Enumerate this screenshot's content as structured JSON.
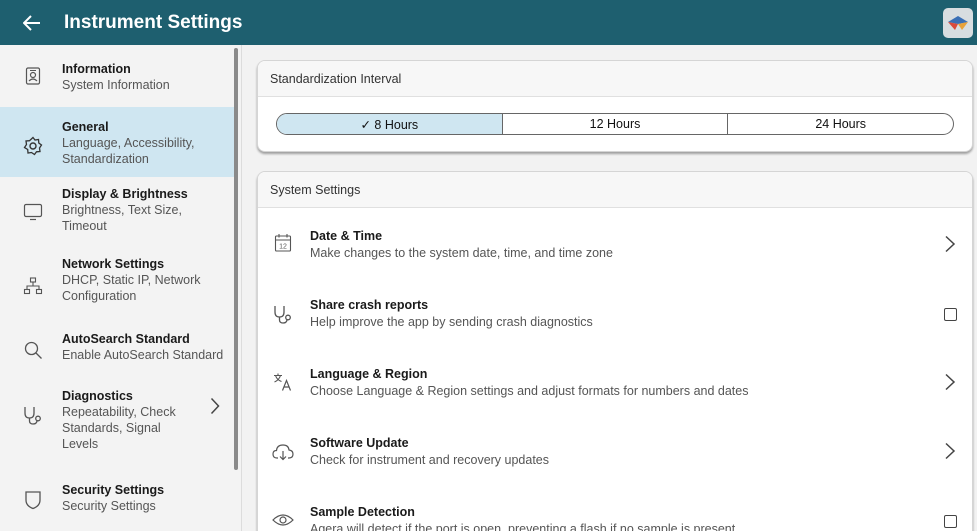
{
  "header": {
    "title": "Instrument Settings",
    "back_icon": "arrow-left-icon",
    "logo_icon": "app-logo-icon"
  },
  "sidebar": {
    "items": [
      {
        "title": "Information",
        "sub": "System Information",
        "icon": "id-badge-icon"
      },
      {
        "title": "General",
        "sub": "Language, Accessibility, Standardization",
        "icon": "gear-icon",
        "selected": true
      },
      {
        "title": "Display & Brightness",
        "sub": "Brightness, Text Size, Timeout",
        "icon": "monitor-icon"
      },
      {
        "title": "Network Settings",
        "sub": "DHCP, Static IP, Network Configuration",
        "icon": "network-icon"
      },
      {
        "title": "AutoSearch Standard",
        "sub": "Enable AutoSearch Standard",
        "icon": "search-icon"
      },
      {
        "title": "Diagnostics",
        "sub": "Repeatability, Check Standards, Signal Levels",
        "icon": "stethoscope-icon"
      },
      {
        "title": "Security Settings",
        "sub": "Security Settings",
        "icon": "shield-icon"
      }
    ]
  },
  "standardization": {
    "header": "Standardization Interval",
    "options": [
      "✓ 8 Hours",
      "12 Hours",
      "24 Hours"
    ],
    "selected_index": 0
  },
  "system_settings": {
    "header": "System Settings",
    "rows": [
      {
        "title": "Date & Time",
        "sub": "Make changes to the system date, time, and time zone",
        "icon": "calendar-icon",
        "control": "chevron",
        "calendar_day": "12"
      },
      {
        "title": "Share crash reports",
        "sub": "Help improve the app by sending crash diagnostics",
        "icon": "stethoscope-icon",
        "control": "checkbox",
        "checked": false
      },
      {
        "title": "Language & Region",
        "sub": "Choose Language & Region settings and adjust formats for numbers and dates",
        "icon": "translate-icon",
        "control": "chevron"
      },
      {
        "title": "Software Update",
        "sub": "Check for instrument and recovery updates",
        "icon": "cloud-download-icon",
        "control": "chevron"
      },
      {
        "title": "Sample Detection",
        "sub": "Agera will detect if the port is open, preventing a flash if no sample is present",
        "icon": "eye-icon",
        "control": "checkbox",
        "checked": false
      }
    ]
  },
  "colors": {
    "header_bg": "#1e5f6f",
    "selected_bg": "#cfe6f1"
  }
}
